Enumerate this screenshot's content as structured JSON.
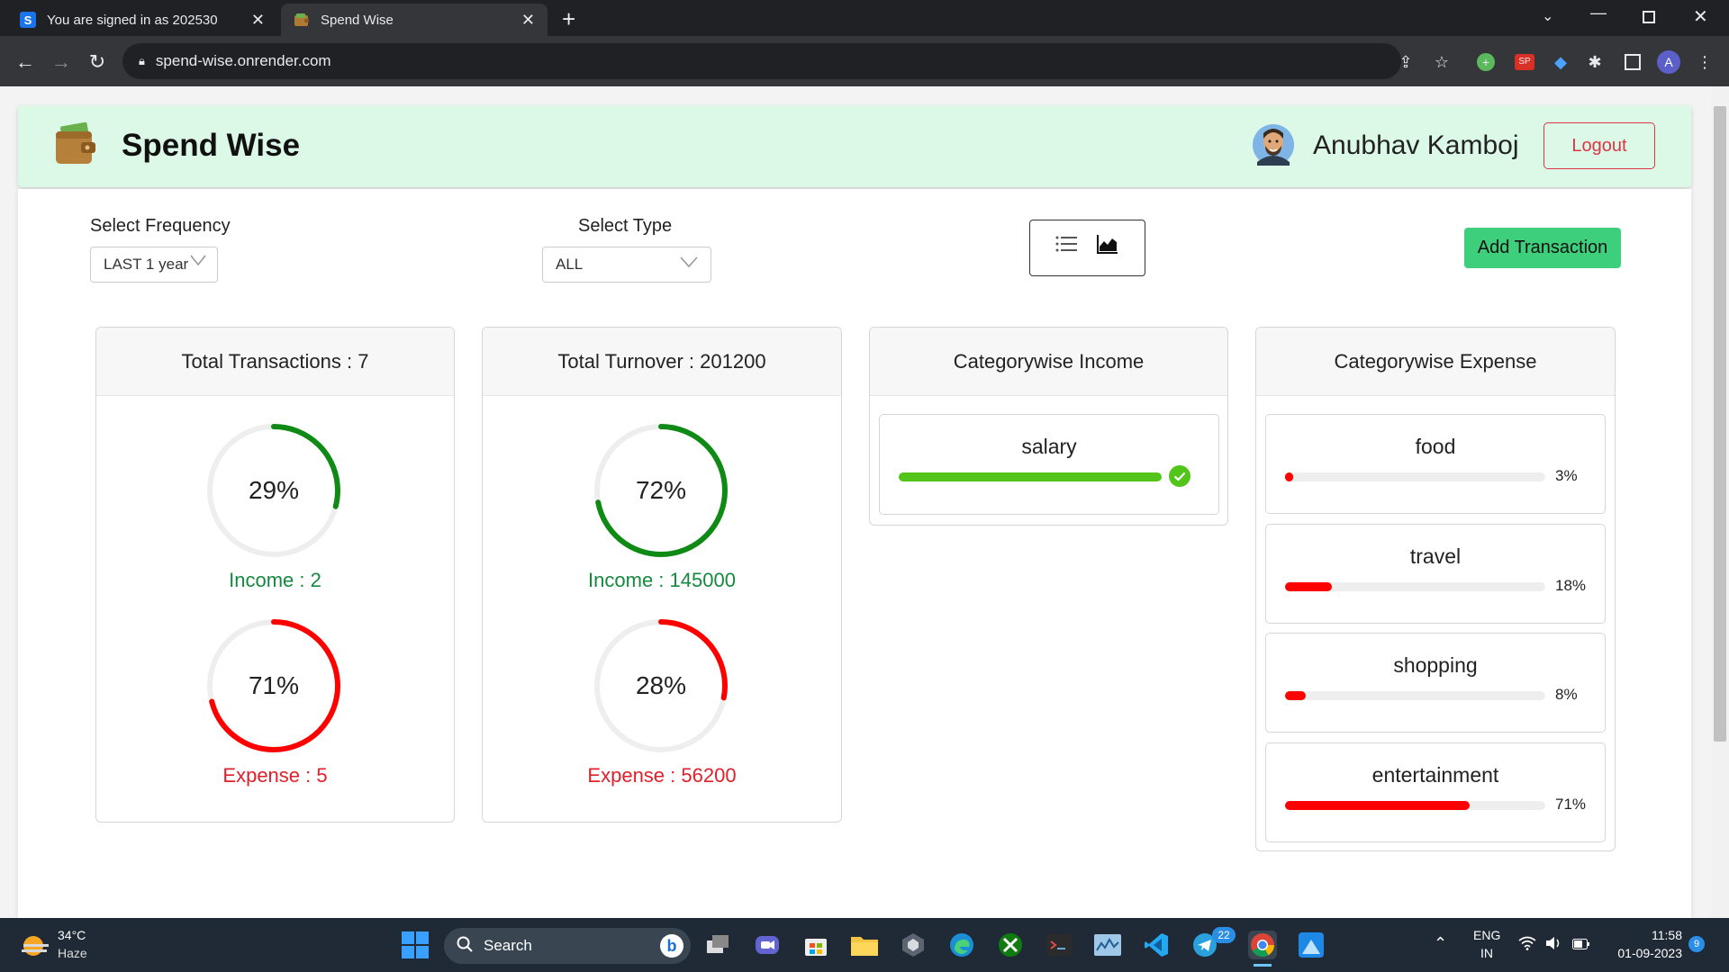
{
  "browser": {
    "tabs": [
      {
        "icon_text": "S",
        "title": "You are signed in as 202530"
      },
      {
        "icon_text": "",
        "title": "Spend Wise"
      }
    ],
    "url": "spend-wise.onrender.com"
  },
  "app": {
    "title": "Spend Wise",
    "user_name": "Anubhav Kamboj",
    "logout_label": "Logout"
  },
  "filters": {
    "frequency_label": "Select Frequency",
    "frequency_value": "LAST 1 year",
    "type_label": "Select Type",
    "type_value": "ALL",
    "add_label": "Add Transaction"
  },
  "cards": {
    "transactions": {
      "title": "Total Transactions : 7",
      "income_pct": 29,
      "income_pct_text": "29%",
      "income_label": "Income : 2",
      "expense_pct": 71,
      "expense_pct_text": "71%",
      "expense_label": "Expense : 5"
    },
    "turnover": {
      "title": "Total Turnover : 201200",
      "income_pct": 72,
      "income_pct_text": "72%",
      "income_label": "Income : 145000",
      "expense_pct": 28,
      "expense_pct_text": "28%",
      "expense_label": "Expense : 56200"
    },
    "category_income": {
      "title": "Categorywise Income",
      "items": [
        {
          "name": "salary",
          "pct": 100
        }
      ]
    },
    "category_expense": {
      "title": "Categorywise Expense",
      "items": [
        {
          "name": "food",
          "pct": 3,
          "pct_text": "3%"
        },
        {
          "name": "travel",
          "pct": 18,
          "pct_text": "18%"
        },
        {
          "name": "shopping",
          "pct": 8,
          "pct_text": "8%"
        },
        {
          "name": "entertainment",
          "pct": 71,
          "pct_text": "71%"
        }
      ]
    }
  },
  "colors": {
    "income": "#158a3e",
    "ring_income": "#0f8a14",
    "expense": "#ff0000",
    "salary_bar": "#52c41a",
    "add_button": "#3ecf7c"
  },
  "taskbar": {
    "weather_temp": "34°C",
    "weather_text": "Haze",
    "search_label": "Search",
    "lang": "ENG",
    "region": "IN",
    "time": "11:58",
    "date": "01-09-2023",
    "telegram_badge": "22",
    "notif_badge": "9"
  }
}
